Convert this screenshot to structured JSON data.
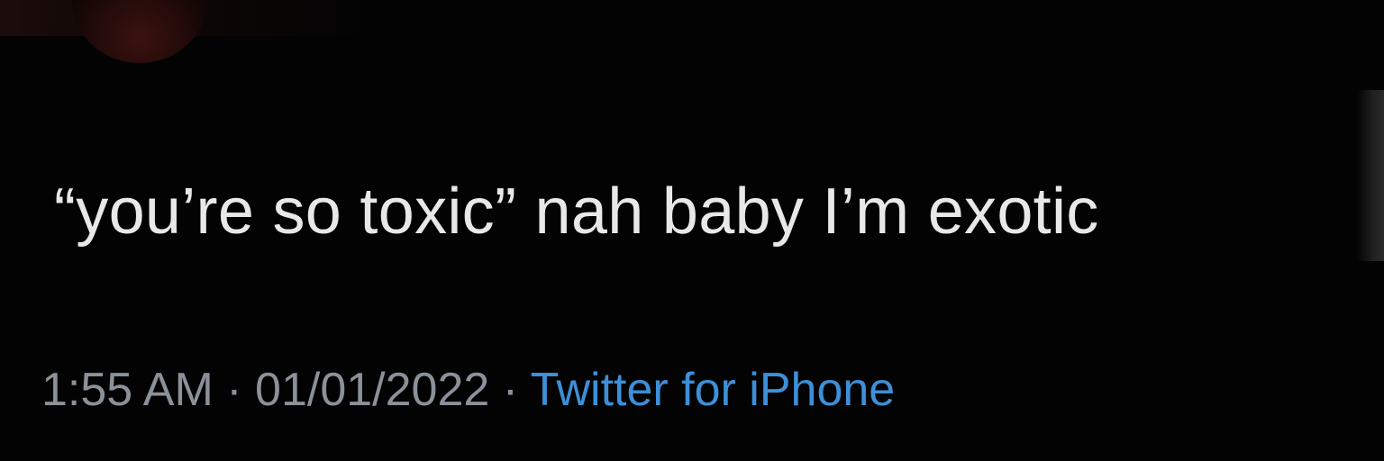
{
  "tweet": {
    "text": "“you’re so toxic” nah baby I’m exotic",
    "time": "1:55 AM",
    "separator": "·",
    "date": "01/01/2022",
    "source": "Twitter for iPhone"
  },
  "colors": {
    "background": "#030303",
    "text": "#e8e8e8",
    "meta": "#8b9199",
    "link": "#3d8fd8"
  }
}
